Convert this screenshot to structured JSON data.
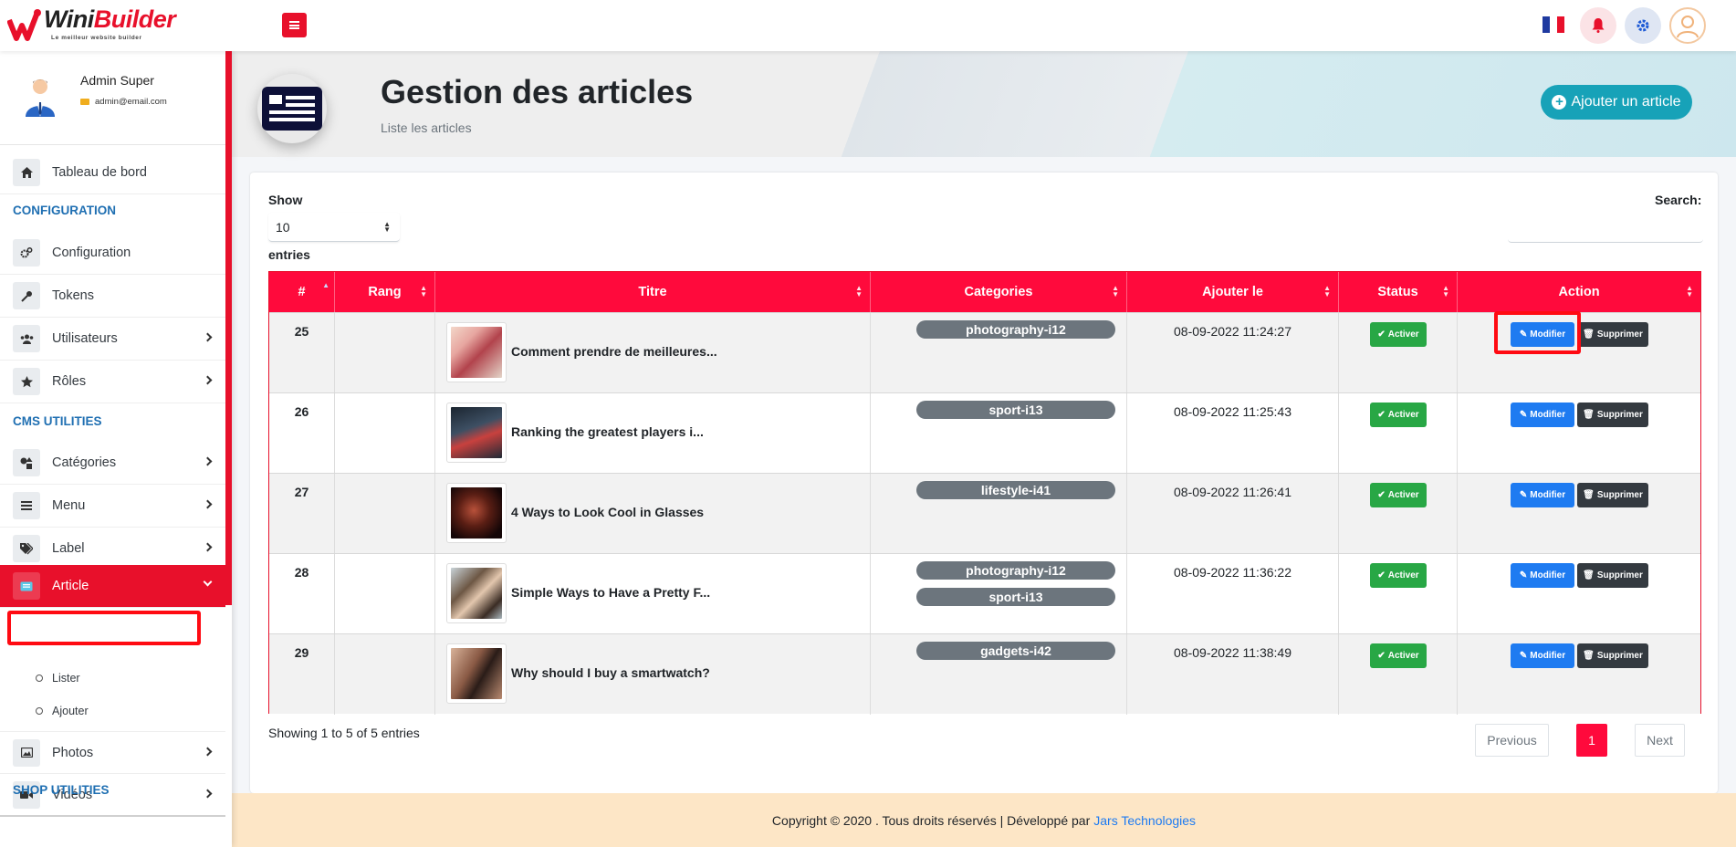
{
  "brand": {
    "name_part1": "Wini",
    "name_part2": "Builder",
    "tagline": "Le meilleur website builder"
  },
  "topbar": {
    "language": "fr"
  },
  "user": {
    "name": "Admin Super",
    "email": "admin@email.com"
  },
  "sidebar": {
    "dashboard": "Tableau de bord",
    "sections": [
      {
        "header": "CONFIGURATION"
      },
      {
        "header": "CMS UTILITIES"
      },
      {
        "header": "SHOP UTILITIES"
      }
    ],
    "items": {
      "configuration": "Configuration",
      "tokens": "Tokens",
      "utilisateurs": "Utilisateurs",
      "roles": "Rôles",
      "categories": "Catégories",
      "menu": "Menu",
      "label": "Label",
      "article": "Article",
      "photos": "Photos",
      "videos": "Vidéos"
    },
    "article_sub": {
      "lister": "Lister",
      "ajouter": "Ajouter"
    }
  },
  "page": {
    "title": "Gestion des articles",
    "subtitle": "Liste les articles",
    "add_button": "Ajouter un article"
  },
  "table_controls": {
    "show_label": "Show",
    "entries_value": "10",
    "entries_label": "entries",
    "search_label": "Search:",
    "search_value": ""
  },
  "table": {
    "columns": [
      "#",
      "Rang",
      "Titre",
      "Categories",
      "Ajouter le",
      "Status",
      "Action"
    ],
    "rows": [
      {
        "id": "25",
        "title": "Comment prendre de meilleures...",
        "categories": [
          "photography-i12"
        ],
        "date": "08-09-2022 11:24:27",
        "status": "Activer",
        "edit": "Modifier",
        "delete": "Supprimer"
      },
      {
        "id": "26",
        "title": "Ranking the greatest players i...",
        "categories": [
          "sport-i13"
        ],
        "date": "08-09-2022 11:25:43",
        "status": "Activer",
        "edit": "Modifier",
        "delete": "Supprimer"
      },
      {
        "id": "27",
        "title": "4 Ways to Look Cool in Glasses",
        "categories": [
          "lifestyle-i41"
        ],
        "date": "08-09-2022 11:26:41",
        "status": "Activer",
        "edit": "Modifier",
        "delete": "Supprimer"
      },
      {
        "id": "28",
        "title": "Simple Ways to Have a Pretty F...",
        "categories": [
          "photography-i12",
          "sport-i13"
        ],
        "date": "08-09-2022 11:36:22",
        "status": "Activer",
        "edit": "Modifier",
        "delete": "Supprimer"
      },
      {
        "id": "29",
        "title": "Why should I buy a smartwatch?",
        "categories": [
          "gadgets-i42"
        ],
        "date": "08-09-2022 11:38:49",
        "status": "Activer",
        "edit": "Modifier",
        "delete": "Supprimer"
      }
    ]
  },
  "pagination": {
    "info": "Showing 1 to 5 of 5 entries",
    "previous": "Previous",
    "current": "1",
    "next": "Next"
  },
  "footer": {
    "text": "Copyright © 2020 . Tous droits réservés | Développé par",
    "link": "Jars Technologies"
  },
  "colors": {
    "brand_red": "#e8102b",
    "header_red": "#ff0a3c",
    "teal": "#17a2b8",
    "blue": "#1e7bf1",
    "green": "#28a745",
    "dark": "#343a40",
    "footer_bg": "#fde6c6"
  }
}
